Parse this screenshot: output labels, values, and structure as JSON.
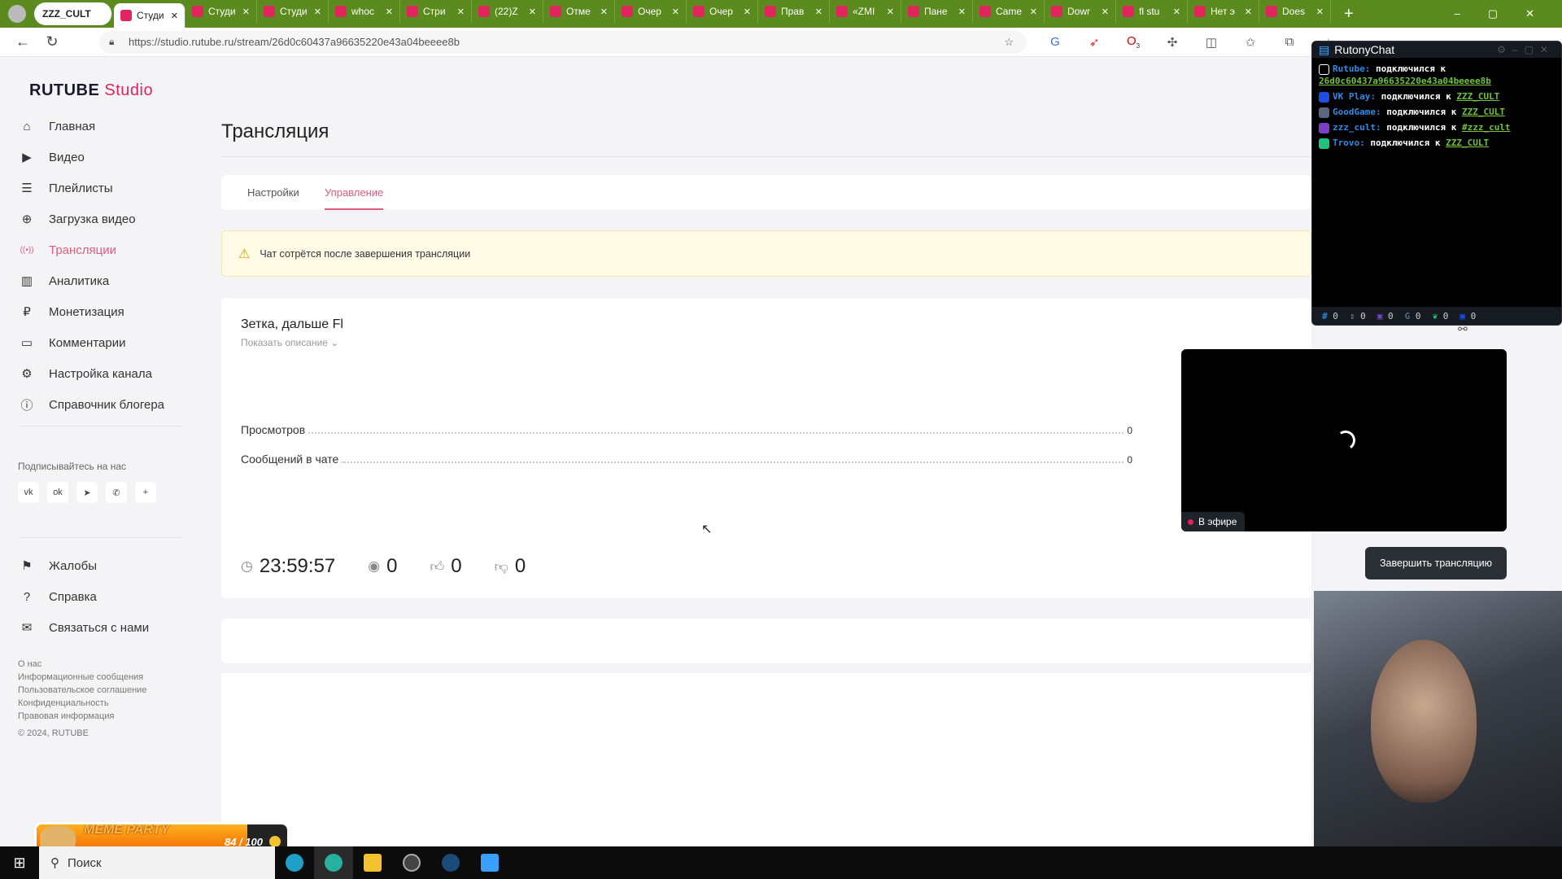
{
  "browser": {
    "profile": "ZZZ_CULT",
    "tabs": [
      {
        "label": "Студи",
        "active": true
      },
      {
        "label": "Студи"
      },
      {
        "label": "Студи"
      },
      {
        "label": "whoc"
      },
      {
        "label": "Стри"
      },
      {
        "label": "(22)Z"
      },
      {
        "label": "Отме"
      },
      {
        "label": "Очер"
      },
      {
        "label": "Очер"
      },
      {
        "label": "Прав"
      },
      {
        "label": "«ZMI"
      },
      {
        "label": "Пане"
      },
      {
        "label": "Came"
      },
      {
        "label": "Dowr"
      },
      {
        "label": "fl stu"
      },
      {
        "label": "Нет э"
      },
      {
        "label": "Does"
      }
    ],
    "url": "https://studio.rutube.ru/stream/26d0c60437a96635220e43a04beeee8b",
    "extension_badge": "3"
  },
  "sidebar": {
    "logo": "RUTUBE Studio",
    "logo_main": "RUTUBE",
    "logo_sub": "Studio",
    "items": [
      {
        "label": "Главная",
        "icon": "home-icon"
      },
      {
        "label": "Видео",
        "icon": "video-icon"
      },
      {
        "label": "Плейлисты",
        "icon": "list-icon"
      },
      {
        "label": "Загрузка видео",
        "icon": "upload-icon"
      },
      {
        "label": "Трансляции",
        "icon": "broadcast-icon",
        "active": true
      },
      {
        "label": "Аналитика",
        "icon": "chart-icon"
      },
      {
        "label": "Монетизация",
        "icon": "ruble-icon"
      },
      {
        "label": "Комментарии",
        "icon": "comment-icon"
      },
      {
        "label": "Настройка канала",
        "icon": "gear-icon"
      },
      {
        "label": "Справочник блогера",
        "icon": "info-icon"
      }
    ],
    "follow_label": "Подписывайтесь на нас",
    "socials": [
      "vk",
      "ok",
      "telegram",
      "viber",
      "more"
    ],
    "bottom_items": [
      {
        "label": "Жалобы",
        "icon": "flag-icon"
      },
      {
        "label": "Справка",
        "icon": "help-icon"
      },
      {
        "label": "Связаться с нами",
        "icon": "mail-icon"
      }
    ],
    "footer_links": [
      "О нас",
      "Информационные сообщения",
      "Пользовательское соглашение",
      "Конфиденциальность",
      "Правовая информация"
    ],
    "copyright": "© 2024, RUTUBE"
  },
  "main": {
    "title": "Трансляция",
    "tabs": [
      {
        "label": "Настройки"
      },
      {
        "label": "Управление",
        "active": true
      }
    ],
    "warning": "Чат сотрётся после завершения трансляции",
    "stream_title": "Зетка, дальше Fl",
    "show_description": "Показать описание",
    "stats": [
      {
        "label": "Просмотров",
        "value": "0"
      },
      {
        "label": "Сообщений в чате",
        "value": "0"
      }
    ],
    "timer": "23:59:57",
    "viewers": "0",
    "likes": "0",
    "dislikes": "0",
    "live_label": "В эфире",
    "end_button": "Завершить трансляцию"
  },
  "rutony": {
    "title": "RutonyChat",
    "lines": [
      {
        "platform": "Rutube:",
        "text": "подключился к",
        "link": "26d0c60437a96635220e43a04beeee8b",
        "color": "#ffffff"
      },
      {
        "platform": "VK Play:",
        "text": "подключился к",
        "link": "ZZZ_CULT",
        "color": "#1f4fe0"
      },
      {
        "platform": "GoodGame:",
        "text": "подключился к",
        "link": "ZZZ_CULT",
        "color": "#5a6580"
      },
      {
        "platform": "zzz_cult:",
        "text": "подключился к",
        "link": "#zzz_cult",
        "color": "#7b3fc8"
      },
      {
        "platform": "Trovo:",
        "text": "подключился к",
        "link": "ZZZ_CULT",
        "color": "#1fc47a"
      }
    ],
    "counters": [
      "0",
      "0",
      "0",
      "0",
      "0",
      "0"
    ]
  },
  "widget": {
    "title": "MEME PARTY",
    "progress": "84 / 100",
    "progress_value": 84,
    "progress_max": 100
  },
  "taskbar": {
    "search": "Поиск"
  },
  "colors": {
    "accent": "#e35b7c",
    "tabbar": "#5b8a1f",
    "warning_bg": "#fffbe6"
  }
}
